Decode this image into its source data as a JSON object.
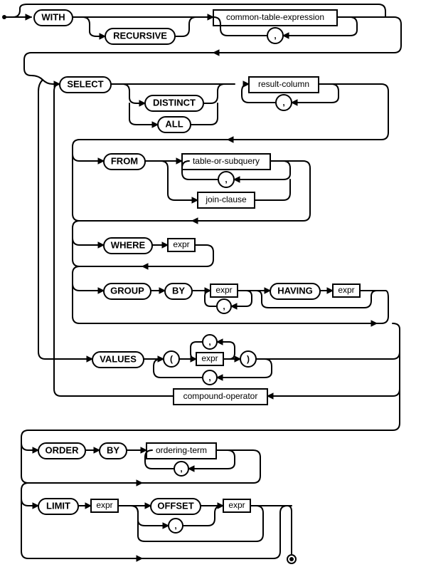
{
  "diagram": {
    "name": "select-stmt",
    "type": "railroad-syntax-diagram",
    "language": "SQL / SQLite",
    "keywords": {
      "with": "WITH",
      "recursive": "RECURSIVE",
      "select": "SELECT",
      "distinct": "DISTINCT",
      "all": "ALL",
      "from": "FROM",
      "where": "WHERE",
      "group": "GROUP",
      "by": "BY",
      "having": "HAVING",
      "values": "VALUES",
      "order": "ORDER",
      "by2": "BY",
      "limit": "LIMIT",
      "offset": "OFFSET",
      "lparen": "(",
      "rparen": ")",
      "comma": ",",
      "expr": "expr"
    },
    "rules": {
      "cte": "common-table-expression",
      "resultcol": "result-column",
      "tabsub": "table-or-subquery",
      "joinclause": "join-clause",
      "compop": "compound-operator",
      "orderterm": "ordering-term"
    }
  }
}
